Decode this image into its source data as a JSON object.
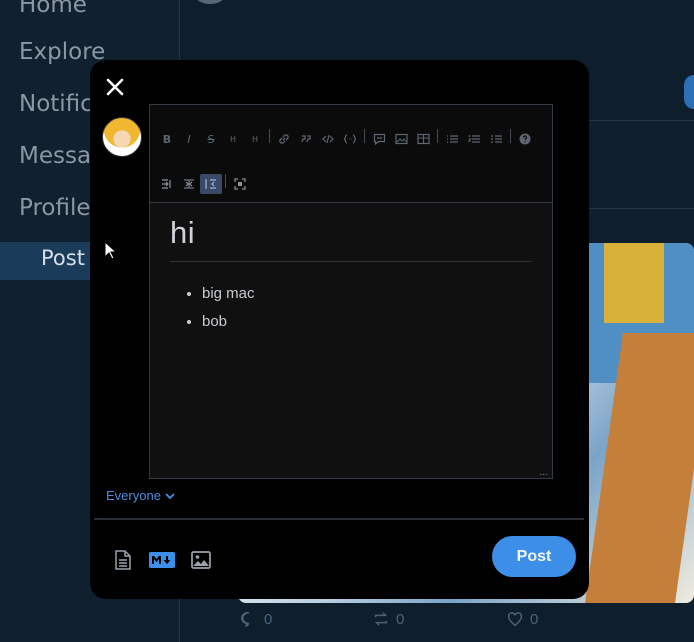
{
  "sidebar": {
    "items": [
      {
        "label": "Home"
      },
      {
        "label": "Explore"
      },
      {
        "label": "Notific"
      },
      {
        "label": "Messa"
      },
      {
        "label": "Profile"
      },
      {
        "label": "Post"
      }
    ]
  },
  "feed": {
    "post_actions": {
      "replies": "0",
      "reposts": "0",
      "likes": "0"
    }
  },
  "composer": {
    "editor": {
      "heading": "hi",
      "list_items": [
        "big mac",
        "bob"
      ],
      "toolbar_row1": [
        "B",
        "I",
        "S",
        "H",
        "H"
      ],
      "resize_glyph": "..."
    },
    "audience_label": "Everyone",
    "post_label": "Post"
  },
  "colors": {
    "accent": "#3d8ee6",
    "modal_bg": "#000000",
    "page_bg": "#0f1f2f"
  }
}
